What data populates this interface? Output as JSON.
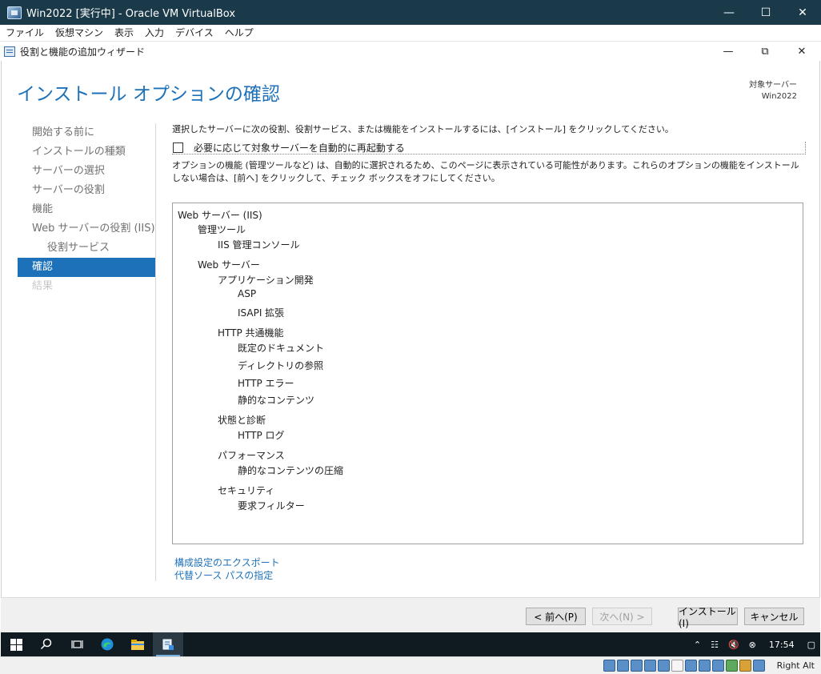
{
  "vbox": {
    "title": "Win2022 [実行中] - Oracle VM VirtualBox",
    "menu": [
      "ファイル",
      "仮想マシン",
      "表示",
      "入力",
      "デバイス",
      "ヘルプ"
    ],
    "host_key": "Right Alt"
  },
  "wizard": {
    "title": "役割と機能の追加ウィザード",
    "page_title": "インストール オプションの確認",
    "target_label": "対象サーバー",
    "target_server": "Win2022",
    "nav": [
      {
        "label": "開始する前に",
        "state": "normal"
      },
      {
        "label": "インストールの種類",
        "state": "normal"
      },
      {
        "label": "サーバーの選択",
        "state": "normal"
      },
      {
        "label": "サーバーの役割",
        "state": "normal"
      },
      {
        "label": "機能",
        "state": "normal"
      },
      {
        "label": "Web サーバーの役割 (IIS)",
        "state": "normal"
      },
      {
        "label": "役割サービス",
        "state": "sub"
      },
      {
        "label": "確認",
        "state": "active"
      },
      {
        "label": "結果",
        "state": "disabled"
      }
    ],
    "intro": "選択したサーバーに次の役割、役割サービス、または機能をインストールするには、[インストール] をクリックしてください。",
    "restart_label": "必要に応じて対象サーバーを自動的に再起動する",
    "restart_checked": false,
    "optional_note": "オプションの機能 (管理ツールなど) は、自動的に選択されるため、このページに表示されている可能性があります。これらのオプションの機能をインストールしない場合は、[前へ] をクリックして、チェック ボックスをオフにしてください。",
    "summary": [
      {
        "label": "Web サーバー (IIS)",
        "level": 0
      },
      {
        "label": "管理ツール",
        "level": 1
      },
      {
        "label": "IIS 管理コンソール",
        "level": 2
      },
      {
        "label": "Web サーバー",
        "level": 1
      },
      {
        "label": "アプリケーション開発",
        "level": 2
      },
      {
        "label": "ASP",
        "level": 3
      },
      {
        "label": "ISAPI 拡張",
        "level": 3
      },
      {
        "label": "HTTP 共通機能",
        "level": 2
      },
      {
        "label": "既定のドキュメント",
        "level": 3
      },
      {
        "label": "ディレクトリの参照",
        "level": 3
      },
      {
        "label": "HTTP エラー",
        "level": 3
      },
      {
        "label": "静的なコンテンツ",
        "level": 3
      },
      {
        "label": "状態と診断",
        "level": 2
      },
      {
        "label": "HTTP ログ",
        "level": 3
      },
      {
        "label": "パフォーマンス",
        "level": 2
      },
      {
        "label": "静的なコンテンツの圧縮",
        "level": 3
      },
      {
        "label": "セキュリティ",
        "level": 2
      },
      {
        "label": "要求フィルター",
        "level": 3
      }
    ],
    "links": [
      "構成設定のエクスポート",
      "代替ソース パスの指定"
    ],
    "buttons": {
      "prev": "< 前へ(P)",
      "next": "次へ(N) >",
      "install": "インストール(I)",
      "cancel": "キャンセル"
    }
  },
  "taskbar": {
    "clock": "17:54"
  }
}
